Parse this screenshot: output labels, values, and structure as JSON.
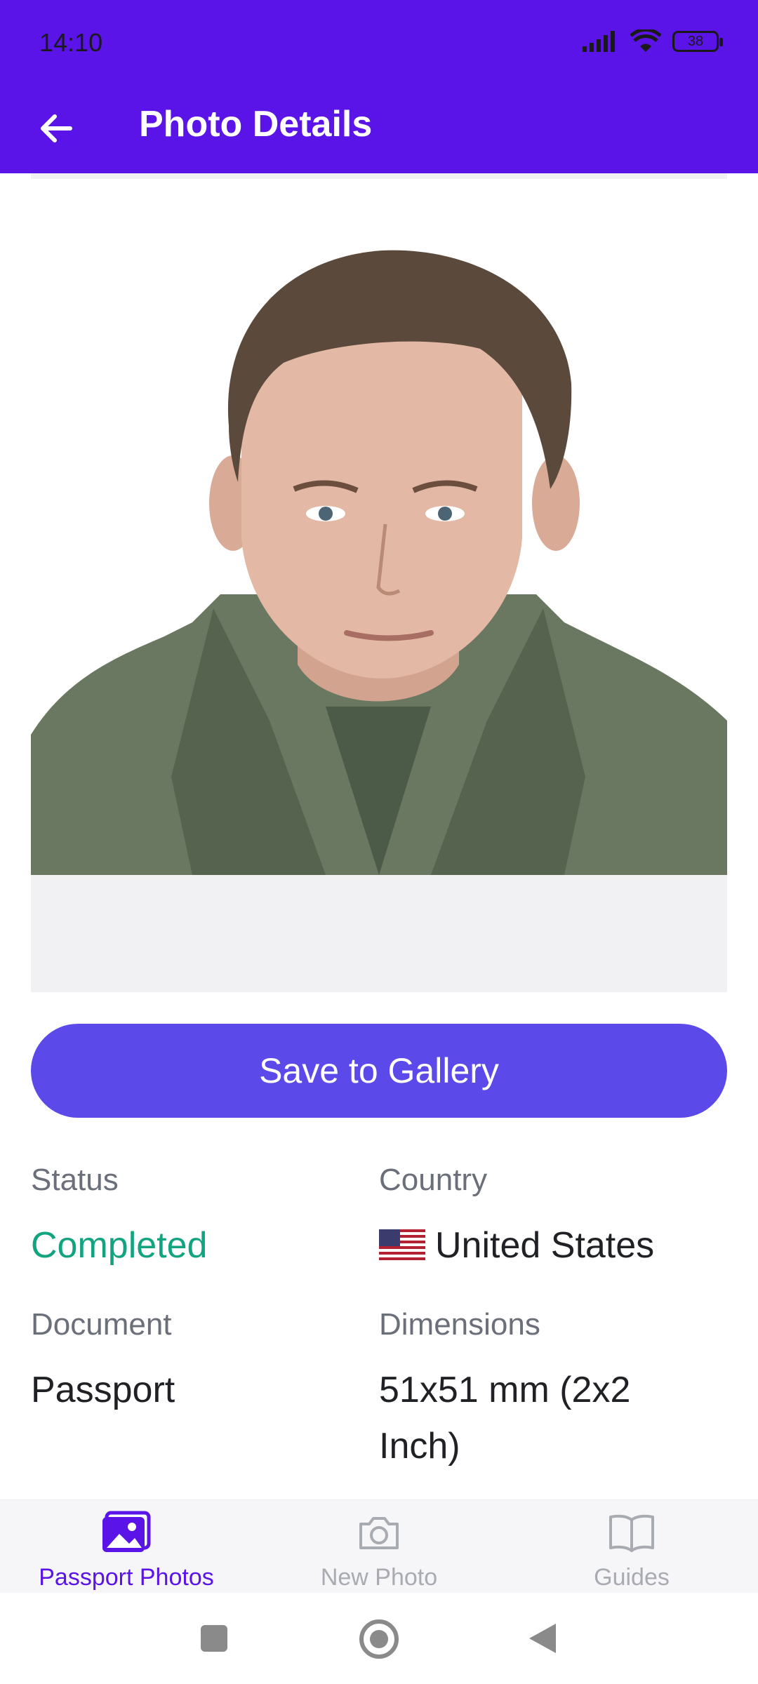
{
  "status_bar": {
    "time": "14:10",
    "battery": "38"
  },
  "app_bar": {
    "title": "Photo Details"
  },
  "actions": {
    "save_label": "Save to Gallery"
  },
  "details": {
    "status_label": "Status",
    "status_value": "Completed",
    "country_label": "Country",
    "country_value": "United States",
    "document_label": "Document",
    "document_value": "Passport",
    "dimensions_label": "Dimensions",
    "dimensions_value": "51x51 mm (2x2 Inch)"
  },
  "bottom_nav": {
    "items": [
      {
        "label": "Passport Photos",
        "icon": "photos-icon",
        "active": true
      },
      {
        "label": "New Photo",
        "icon": "camera-icon",
        "active": false
      },
      {
        "label": "Guides",
        "icon": "book-icon",
        "active": false
      }
    ]
  },
  "colors": {
    "primary": "#5a14e8",
    "button": "#5b4ae9",
    "success": "#12a37f"
  }
}
